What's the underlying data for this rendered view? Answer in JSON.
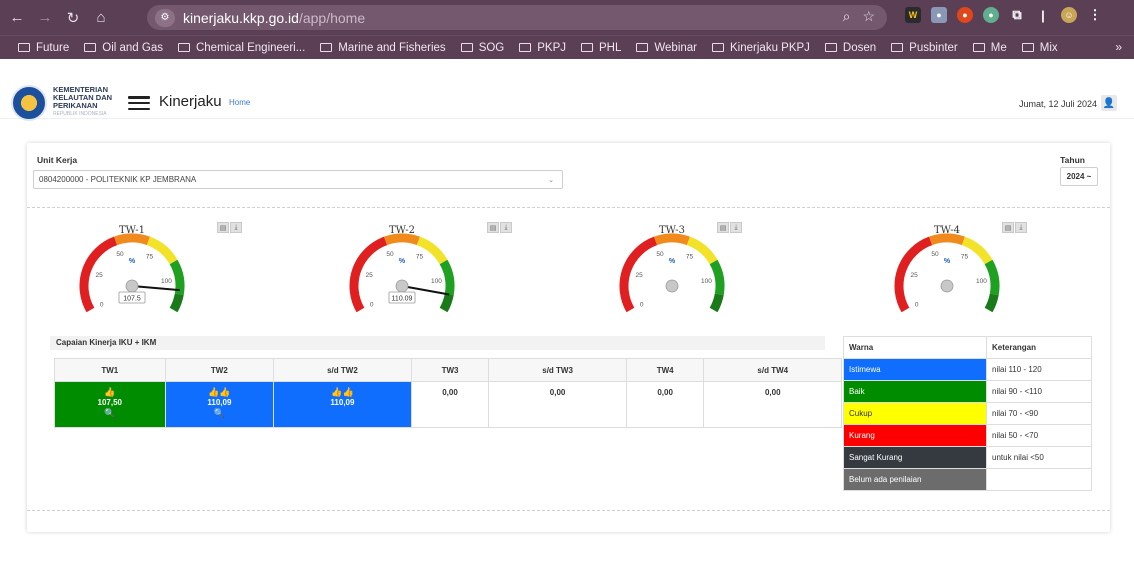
{
  "browser": {
    "url_host": "kinerjaku.kkp.go.id",
    "url_path": "/app/home",
    "bookmarks": [
      "Future",
      "Oil and Gas",
      "Chemical Engineeri...",
      "Marine and Fisheries",
      "SOG",
      "PKPJ",
      "PHL",
      "Webinar",
      "Kinerjaku PKPJ",
      "Dosen",
      "Pusbinter",
      "Me",
      "Mix"
    ],
    "more": "»",
    "ext_icons": [
      "W-extension-icon",
      "chat-extension-icon",
      "record-extension-icon",
      "circle-extension-icon",
      "puzzle-icon",
      "profile-avatar-icon"
    ]
  },
  "header": {
    "logo_line1": "KEMENTERIAN",
    "logo_line2": "KELAUTAN DAN",
    "logo_line3": "PERIKANAN",
    "logo_sub": "REPUBLIK INDONESIA",
    "title": "Kinerjaku",
    "crumb": "Home",
    "date": "Jumat, 12 Juli 2024"
  },
  "filters": {
    "unit_label": "Unit Kerja",
    "unit_value": "0804200000 - POLITEKNIK KP JEMBRANA",
    "tahun_label": "Tahun",
    "tahun_value": "2024 ~"
  },
  "gauges": [
    {
      "label": "TW-1",
      "value": 107.5,
      "readout": "107.5"
    },
    {
      "label": "TW-2",
      "value": 110.09,
      "readout": "110.09"
    },
    {
      "label": "TW-3",
      "value": null,
      "readout": ""
    },
    {
      "label": "TW-4",
      "value": null,
      "readout": ""
    }
  ],
  "gauge_ticks": [
    "0",
    "25",
    "50",
    "75",
    "100"
  ],
  "gauge_unit": "%",
  "capaian": {
    "title": "Capaian Kinerja IKU + IKM",
    "headers": [
      "TW1",
      "TW2",
      "s/d TW2",
      "TW3",
      "s/d TW3",
      "TW4",
      "s/d TW4"
    ],
    "cells": [
      {
        "icon": "👍",
        "value": "107,50",
        "search": "🔍"
      },
      {
        "icon": "👍👍",
        "value": "110,09",
        "search": "🔍"
      },
      {
        "icon": "👍👍",
        "value": "110,09",
        "search": ""
      },
      {
        "icon": "",
        "value": "0,00",
        "search": ""
      },
      {
        "icon": "",
        "value": "0,00",
        "search": ""
      },
      {
        "icon": "",
        "value": "0,00",
        "search": ""
      },
      {
        "icon": "",
        "value": "0,00",
        "search": ""
      }
    ]
  },
  "legend": {
    "col_warna": "Warna",
    "col_ket": "Keterangan",
    "rows": [
      {
        "label": "Istimewa",
        "desc": "nilai 110 - 120",
        "color": "#0f6efd"
      },
      {
        "label": "Baik",
        "desc": "nilai 90 - <110",
        "color": "#008c00"
      },
      {
        "label": "Cukup",
        "desc": "nilai 70 - <90",
        "color": "#ffff00"
      },
      {
        "label": "Kurang",
        "desc": "nilai 50 - <70",
        "color": "#ff0000"
      },
      {
        "label": "Sangat Kurang",
        "desc": "untuk nilai <50",
        "color": "#343a40"
      },
      {
        "label": "Belum ada penilaian",
        "desc": "",
        "color": "#6c6c6c"
      }
    ]
  }
}
